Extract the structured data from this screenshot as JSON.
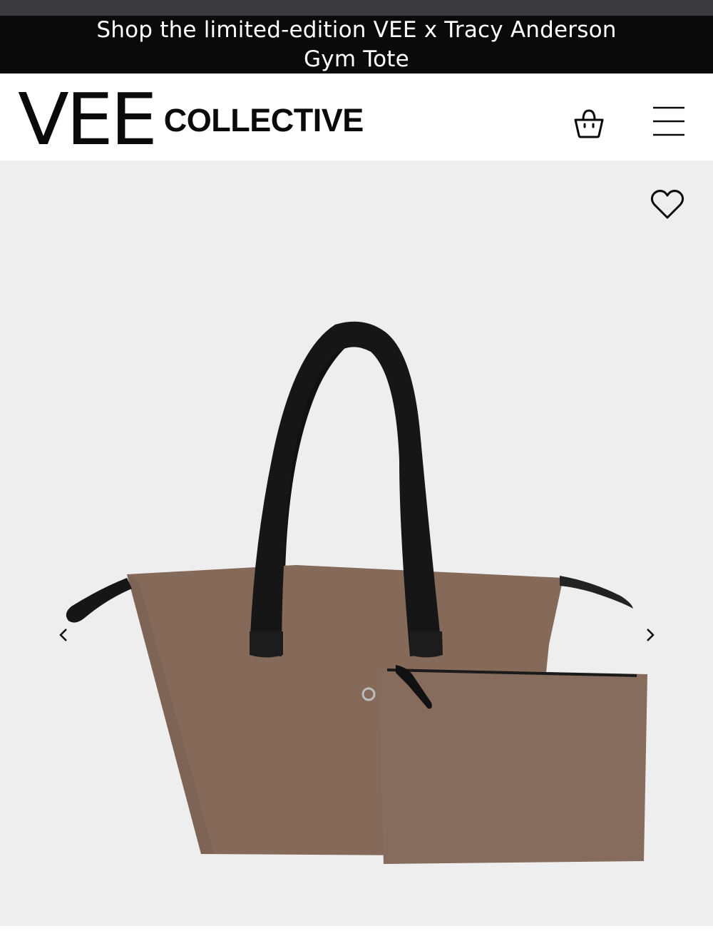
{
  "promo": {
    "text": "Shop the limited-edition VEE x Tracy Anderson Gym Tote"
  },
  "header": {
    "logo_primary": "VEE",
    "logo_secondary": "COLLECTIVE",
    "cart_icon": "shopping-bag-icon",
    "menu_icon": "hamburger-menu-icon"
  },
  "gallery": {
    "wishlist_icon": "heart-icon",
    "prev_icon": "chevron-left-icon",
    "next_icon": "chevron-right-icon",
    "image": "brown tote bag with black handles and matching zip pouch",
    "colors": {
      "background": "#eeeeee",
      "bag": "#856a5a",
      "handles": "#1a1a1a"
    }
  }
}
